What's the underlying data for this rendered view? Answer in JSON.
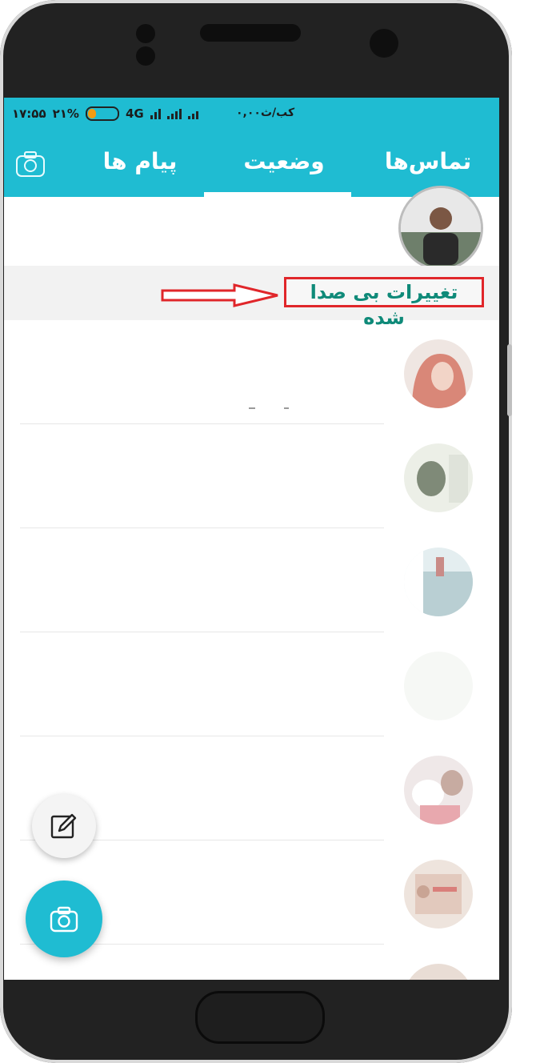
{
  "status_bar": {
    "time": "۱۷:۵۵",
    "battery_percent": "۲۱%",
    "network": "4G",
    "speed": "۰,۰۰کب/ث"
  },
  "tabs": [
    {
      "label": "تماس‌ها",
      "selected": false
    },
    {
      "label": "وضعیت",
      "selected": true
    },
    {
      "label": "پیام ها",
      "selected": false
    }
  ],
  "section": {
    "title": "تغییرات بی صدا شده"
  },
  "icons": {
    "tab_camera": "camera-icon",
    "fab_edit": "pencil-icon",
    "fab_camera": "camera-icon"
  },
  "colors": {
    "accent": "#1fbcd2",
    "annotation_red": "#e0262a",
    "section_text": "#0f8a79"
  }
}
